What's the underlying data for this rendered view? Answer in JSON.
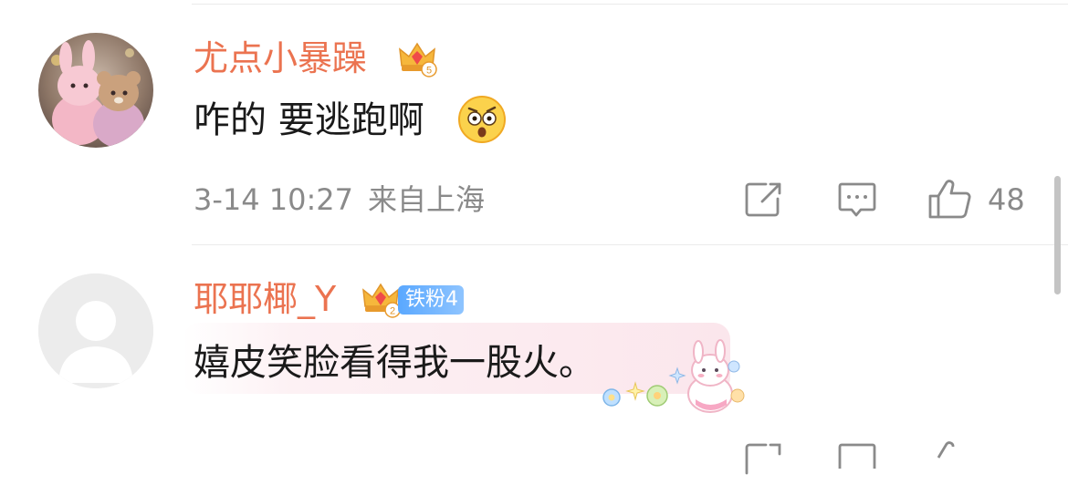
{
  "comments": [
    {
      "username": "尤点小暴躁",
      "crown_level": "5",
      "text": "咋的 要逃跑啊",
      "emoji": "shocked-face-emoji",
      "date": "3-14 10:27",
      "location": "来自上海",
      "likes": "48"
    },
    {
      "username": "耶耶椰_Y",
      "crown_level": "2",
      "fan_badge": "铁粉4",
      "text": "嬉皮笑脸看得我一股火。",
      "sticker": "bunny-flowers-sticker"
    }
  ],
  "icons": {
    "share": "share-icon",
    "reply": "reply-icon",
    "like": "thumbs-up-icon"
  },
  "colors": {
    "username": "#eb7350",
    "meta": "#8a8a8a",
    "text": "#1a1a1a",
    "badge": "#5aa8ff",
    "crown": "#f6b73c"
  }
}
